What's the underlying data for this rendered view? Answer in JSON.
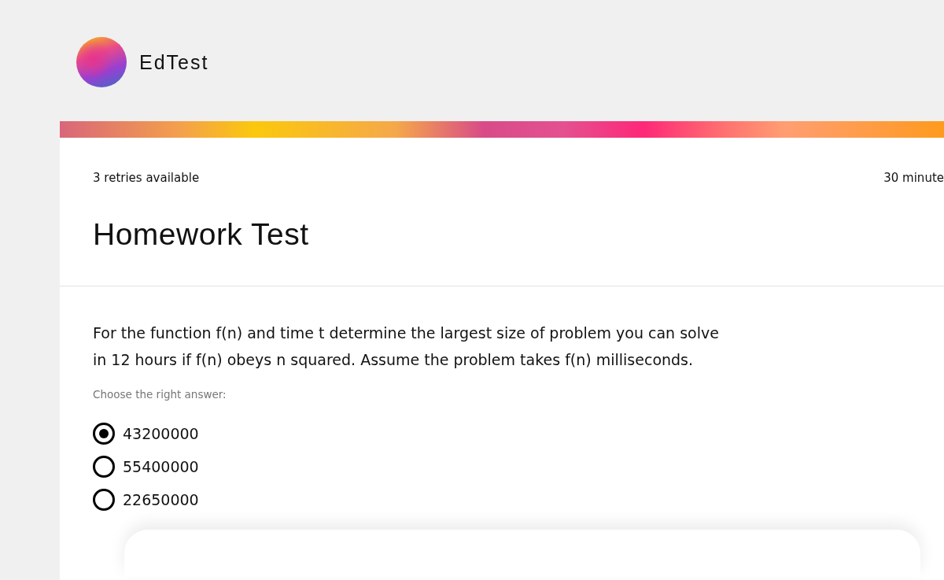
{
  "brand": {
    "name": "EdTest"
  },
  "test": {
    "retries": "3 retries available",
    "time": "30 minute",
    "title": "Homework Test"
  },
  "question": {
    "text": "For the function f(n) and time t determine the largest size of problem you can solve in 12 hours if f(n) obeys n squared. Assume the problem takes f(n) milliseconds.",
    "prompt": "Choose the right answer:",
    "options": [
      {
        "label": "43200000",
        "selected": true
      },
      {
        "label": "55400000",
        "selected": false
      },
      {
        "label": "22650000",
        "selected": false
      }
    ]
  }
}
